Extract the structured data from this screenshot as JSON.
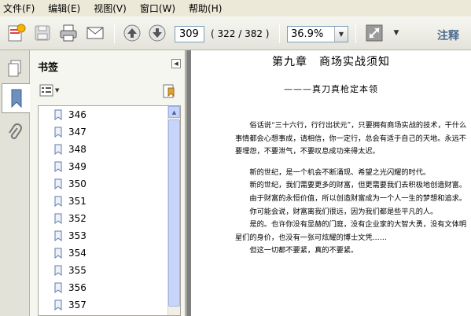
{
  "menu": [
    "文件(F)",
    "编辑(E)",
    "视图(V)",
    "窗口(W)",
    "帮助(H)"
  ],
  "toolbar": {
    "current_page": "309",
    "page_count": "( 322 / 382 )",
    "zoom": "36.9%",
    "annotate_label": "注释"
  },
  "panel": {
    "title": "书签",
    "bookmarks": [
      "346",
      "347",
      "348",
      "349",
      "350",
      "351",
      "352",
      "353",
      "354",
      "355",
      "356",
      "357"
    ]
  },
  "doc": {
    "chapter_title": "第九章　商场实战须知",
    "subtitle": "———真刀真枪定本领",
    "paragraphs": [
      "俗话说“三十六行，行行出状元”，只要拥有商场实战的技术，干什么事情都会心想事成，请相信，你一定行，总会有适于自己的天地。永远不要埋怨，不要泄气，不要叹息成功来得太迟。",
      "新的世纪，是一个机会不断涌现、希望之光闪耀的时代。",
      "新的世纪，我们需要更多的财富，但更需要我们去积极地创造财富。",
      "由于财富的永恒价值，所以创造财富成为一个人一生的梦想和追求。",
      "你可能会说，财富离我们很远，因为我们都是些平凡的人。",
      "是的。也许你没有显赫的门庭，没有企业家的大智大勇，没有文体明星们的身价，也没有一张可炫耀的博士文凭……",
      "但这一切都不要紧，真的不要紧。"
    ]
  }
}
